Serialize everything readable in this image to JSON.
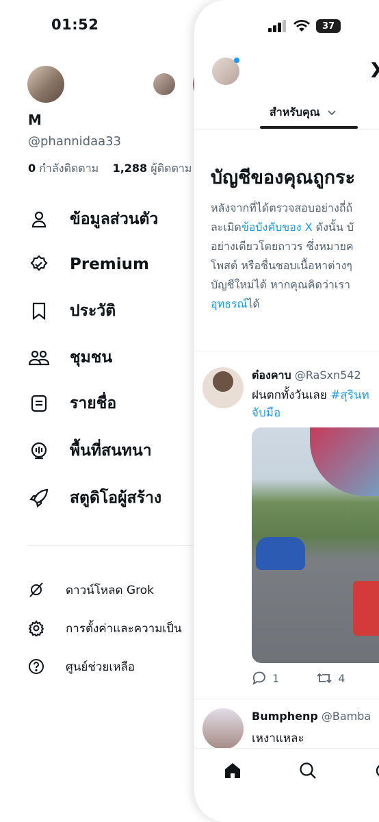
{
  "status": {
    "time": "01:52",
    "battery": "37"
  },
  "profile": {
    "name": "M",
    "handle": "@phannidaa33",
    "following_count": "0",
    "following_label": "กำลังติดตาม",
    "followers_count": "1,288",
    "followers_label": "ผู้ติดตาม"
  },
  "menu": {
    "items": [
      {
        "label": "ข้อมูลส่วนตัว",
        "icon": "person-icon"
      },
      {
        "label": "Premium",
        "icon": "verified-badge-icon"
      },
      {
        "label": "ประวัติ",
        "icon": "bookmark-icon"
      },
      {
        "label": "ชุมชน",
        "icon": "communities-icon"
      },
      {
        "label": "รายชื่อ",
        "icon": "list-icon"
      },
      {
        "label": "พื้นที่สนทนา",
        "icon": "spaces-icon"
      },
      {
        "label": "สตูดิโอผู้สร้าง",
        "icon": "rocket-icon"
      }
    ],
    "secondary": [
      {
        "label": "ดาวน์โหลด Grok",
        "icon": "grok-icon"
      },
      {
        "label": "การตั้งค่าและความเป็น",
        "icon": "gear-icon"
      },
      {
        "label": "ศูนย์ช่วยเหลือ",
        "icon": "help-icon"
      }
    ]
  },
  "feed": {
    "tab_label": "สำหรับคุณ",
    "notice": {
      "title": "บัญชีของคุณถูกระ",
      "line1": "หลังจากที่ได้ตรวจสอบอย่างถี่ถ้",
      "line2_pre": "ละเมิด",
      "line2_link": "ข้อบังคับของ X",
      "line2_post": " ดังนั้น บั",
      "line3": "อย่างเดียวโดยถาวร ซึ่งหมายค",
      "line4": "โพสต์ หรือชื่นชอบเนื้อหาต่างๆ",
      "line5": "บัญชีใหม่ได้ หากคุณคิดว่าเรา",
      "line6_link": "อุทธรณ์",
      "line6_post": "ได้"
    },
    "posts": [
      {
        "author": "ต๋องคาบ",
        "handle": "@RaSxn542",
        "text": "ฝนตกทั้งวันเลย ",
        "hashtag": "#สุรินท",
        "text2": "จับมือ",
        "replies": "1",
        "reposts": "4"
      },
      {
        "author": "Bumphenp",
        "handle": "@Bamba",
        "text": "เหงาแหละ"
      }
    ]
  },
  "colors": {
    "accent": "#1d9bf0",
    "text": "#0f1419",
    "muted": "#536471"
  }
}
